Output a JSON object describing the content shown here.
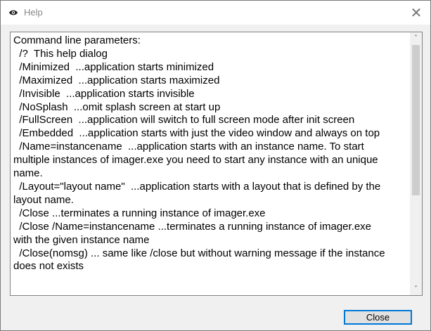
{
  "window": {
    "title": "Help",
    "app_icon": "eye-icon",
    "close_glyph": "✕"
  },
  "help_text": {
    "lines": [
      "Command line parameters:",
      "  /?  This help dialog",
      "  /Minimized  ...application starts minimized",
      "  /Maximized  ...application starts maximized",
      "  /Invisible  ...application starts invisible",
      "  /NoSplash  ...omit splash screen at start up",
      "  /FullScreen  ...application will switch to full screen mode after init screen",
      "  /Embedded  ...application starts with just the video window and always on top",
      "  /Name=instancename  ...application starts with an instance name. To start",
      "multiple instances of imager.exe you need to start any instance with an unique",
      "name.",
      "  /Layout=\"layout name\"  ...application starts with a layout that is defined by the",
      "layout name.",
      "  /Close ...terminates a running instance of imager.exe",
      "  /Close /Name=instancename ...terminates a running instance of imager.exe",
      "with the given instance name",
      "  /Close(nomsg) ... same like /close but without warning message if the instance",
      "does not exists"
    ]
  },
  "scrollbar": {
    "up_arrow": "chevron-up-icon",
    "down_arrow": "chevron-down-icon",
    "up_glyph": "˄",
    "down_glyph": "˅"
  },
  "buttons": {
    "close_label": "Close"
  },
  "colors": {
    "accent": "#0078d7",
    "dialog_bg": "#f0f0f0"
  }
}
